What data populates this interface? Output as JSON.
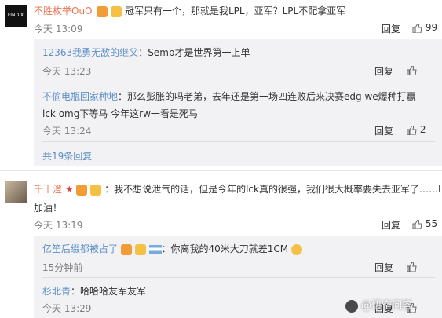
{
  "comment1": {
    "avatar_text": "FIND X",
    "username": "不胜枚举OuO",
    "sep": "：",
    "text": "冠军只有一个，那就是我LPL，亚军？LPL不配拿亚军",
    "time": "今天 13:09",
    "reply_label": "回复",
    "like_count": "99"
  },
  "reply1": {
    "username": "12363我勇无敌的继父",
    "text": "：Semb才是世界第一上单",
    "time": "今天 13:23",
    "reply_label": "回复"
  },
  "reply2": {
    "username": "不偷电瓶回家种地",
    "text_line1": "：那么彭胀的吗老弟，去年还是第一场四连败后来决赛edg we爆种打赢",
    "text_line2": "lck  omg下等马 今年这rw一看是死马",
    "time": "今天 13:24",
    "reply_label": "回复",
    "like_count": "2"
  },
  "more_replies": "共19条回复",
  "comment2": {
    "username": "千丨澄",
    "text_line1": "：我不想说泄气的话，但是今年的lck真的很强，我们很大概率要失去亚军了……LPL",
    "text_line2": "加油！",
    "time": "今天 13:19",
    "reply_label": "回复",
    "like_count": "55"
  },
  "reply3": {
    "username": "亿笙后缀都被占了",
    "text": "：你离我的40米大刀就差1CM",
    "time": "15分钟前",
    "reply_label": "回复"
  },
  "reply4": {
    "username": "杉北青",
    "text": "：哈哈哈友军友军",
    "time": "今天 13:29",
    "reply_label": "回复"
  },
  "watermark": "@悟空问答"
}
